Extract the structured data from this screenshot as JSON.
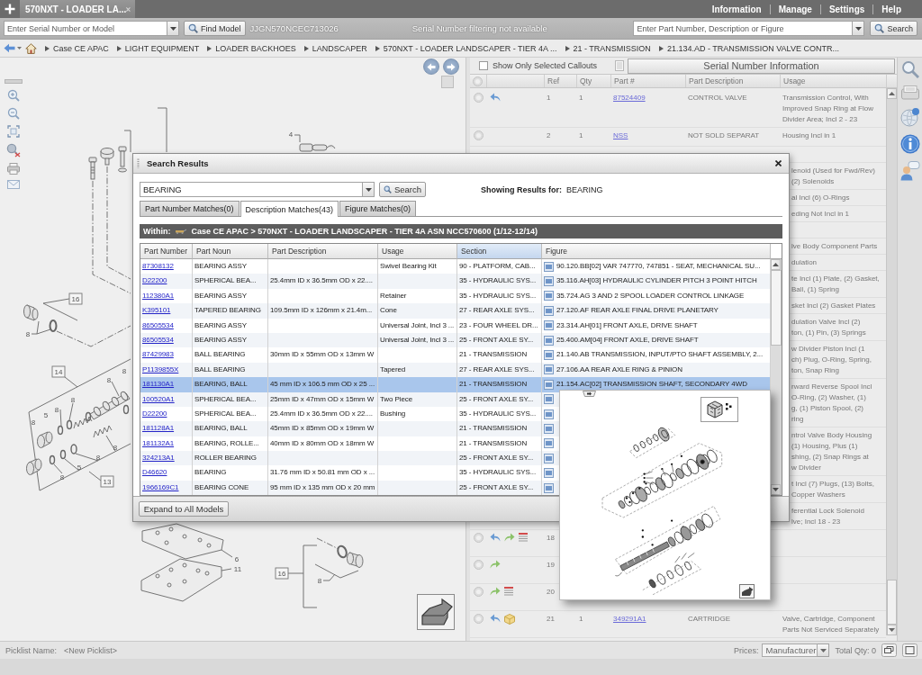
{
  "top_bar": {
    "tabs": [
      {
        "label": "570NXT - LOADER LA...",
        "selected": true
      }
    ],
    "links": [
      "Information",
      "Manage",
      "Settings",
      "Help"
    ]
  },
  "toolbar": {
    "serial_field": {
      "placeholder": "Enter Serial Number or Model"
    },
    "find_button": "Find Model",
    "serial_number": "JJGN570NCEC713026",
    "filter_status": "Serial Number filtering not available",
    "part_field": {
      "placeholder": "Enter Part Number, Description or Figure"
    },
    "search_button": "Search"
  },
  "breadcrumb": [
    "Case CE APAC",
    "LIGHT EQUIPMENT",
    "LOADER BACKHOES",
    "LANDSCAPER",
    "570NXT - LOADER LANDSCAPER - TIER 4A ...",
    "21 - TRANSMISSION",
    "21.134.AD - TRANSMISSION VALVE CONTR..."
  ],
  "diagram": {
    "callouts": [
      {
        "text": "4",
        "boxed": false
      },
      {
        "text": "16",
        "boxed": true
      },
      {
        "text": "8",
        "boxed": false
      },
      {
        "text": "14",
        "boxed": true
      },
      {
        "text": "8",
        "boxed": false
      },
      {
        "text": "8",
        "boxed": false
      },
      {
        "text": "8",
        "boxed": false
      },
      {
        "text": "8",
        "boxed": false
      },
      {
        "text": "5",
        "boxed": false
      },
      {
        "text": "8",
        "boxed": false
      },
      {
        "text": "8",
        "boxed": false
      },
      {
        "text": "8",
        "boxed": false
      },
      {
        "text": "5",
        "boxed": false
      },
      {
        "text": "8",
        "boxed": false
      },
      {
        "text": "13",
        "boxed": true
      },
      {
        "text": "6",
        "boxed": false
      },
      {
        "text": "11",
        "boxed": false
      },
      {
        "text": "16",
        "boxed": true
      },
      {
        "text": "8",
        "boxed": false
      }
    ]
  },
  "parts_panel": {
    "callout_filter": {
      "label": "Show Only Selected Callouts",
      "checked": false
    },
    "serial_info_button": "Serial Number Information",
    "columns": [
      "Ref",
      "Qty",
      "Part #",
      "Part Description",
      "Usage"
    ],
    "rows": [
      {
        "kind": "part",
        "ref": "1",
        "qty": "1",
        "part_number": "87524409",
        "description": "CONTROL VALVE",
        "usage": "Transmission Control, With Improved Snap Ring at Flow Divider Area; Incl 2 - 23",
        "back_ref": true,
        "forward_ref": false,
        "notes": false,
        "kit": false
      },
      {
        "kind": "part",
        "ref": "2",
        "qty": "1",
        "part_number": "NSS",
        "description": "NOT SOLD SEPARAT",
        "usage": "Housing Incl in 1",
        "back_ref": false,
        "forward_ref": false,
        "notes": false,
        "kit": false
      },
      {
        "kind": "covered"
      },
      {
        "kind": "covered",
        "usage": "lenoid (Used for Fwd/Rev)\n(2) Solenoids"
      },
      {
        "kind": "covered",
        "usage": "al Incl (6) O-Rings"
      },
      {
        "kind": "covered",
        "usage": "eding Not Incl in 1"
      },
      {
        "kind": "covered"
      },
      {
        "kind": "covered",
        "usage": "lve Body Component Parts"
      },
      {
        "kind": "covered",
        "usage": "dulation"
      },
      {
        "kind": "covered",
        "usage": "te Incl (1) Plate, (2) Gasket,\nBall, (1) Spring"
      },
      {
        "kind": "covered",
        "usage": "sket Incl (2) Gasket Plates"
      },
      {
        "kind": "covered",
        "usage": "dulation Valve Incl (2)\nton, (1) Pin, (3) Springs"
      },
      {
        "kind": "covered",
        "usage": "w Divider Piston Incl (1\nch) Plug, O-Ring, Spring,\nton, Snap Ring"
      },
      {
        "kind": "covered",
        "usage": "rward Reverse Spool Incl\nO-Ring, (2) Washer, (1)\ng, (1) Piston Spool, (2)\nring"
      },
      {
        "kind": "covered",
        "usage": "ntrol Valve Body Housing\n(1) Housing, Plus (1)\nshing, (2) Snap Rings at\nw Divider"
      },
      {
        "kind": "covered",
        "usage": "t Incl (7) Plugs, (13) Bolts,\nCopper Washers"
      },
      {
        "kind": "covered",
        "usage": "ferential Lock Solenoid\nlve; Incl 18 - 23"
      },
      {
        "kind": "part",
        "ref": "18",
        "back_ref": true,
        "forward_ref": true,
        "notes": true,
        "kit": false
      },
      {
        "kind": "part",
        "ref": "19",
        "back_ref": false,
        "forward_ref": true,
        "notes": false,
        "kit": false
      },
      {
        "kind": "part",
        "ref": "20",
        "back_ref": false,
        "forward_ref": true,
        "notes": true,
        "kit": false
      },
      {
        "kind": "part",
        "ref": "21",
        "qty": "1",
        "part_number": "349291A1",
        "description": "CARTRIDGE",
        "usage": "Valve, Cartridge, Component Parts Not Serviced Separately",
        "back_ref": true,
        "forward_ref": false,
        "notes": false,
        "kit": true
      }
    ]
  },
  "search_dialog": {
    "title": "Search Results",
    "query": "BEARING",
    "search_button": "Search",
    "results_label": "Showing Results for:",
    "results_query": "BEARING",
    "tabs": [
      {
        "label": "Part Number Matches(0)",
        "selected": false
      },
      {
        "label": "Description Matches(43)",
        "selected": true
      },
      {
        "label": "Figure Matches(0)",
        "selected": false
      }
    ],
    "within_label": "Within:",
    "within_path": "Case CE APAC > 570NXT - LOADER LANDSCAPER - TIER 4A ASN NCC570600 (1/12-12/14)",
    "columns": [
      {
        "label": "Part Number",
        "sorted": false
      },
      {
        "label": "Part Noun",
        "sorted": false
      },
      {
        "label": "Part Description",
        "sorted": false
      },
      {
        "label": "Usage",
        "sorted": false
      },
      {
        "label": "Section",
        "sorted": true
      },
      {
        "label": "Figure",
        "sorted": false
      }
    ],
    "rows": [
      {
        "part_number": "87308132",
        "noun": "BEARING ASSY",
        "usage": "Swivel Bearing Kit",
        "section": "90 - PLATFORM, CAB...",
        "figure": "90.120.BB[02] VAR 747770, 747851 - SEAT, MECHANICAL SU...",
        "selected": false
      },
      {
        "part_number": "D22200",
        "noun": "SPHERICAL BEA...",
        "description": "25.4mm ID x 36.5mm OD x 22....",
        "section": "35 - HYDRAULIC SYS...",
        "figure": "35.116.AH[03] HYDRAULIC CYLINDER PITCH 3 POINT HITCH",
        "selected": false
      },
      {
        "part_number": "112380A1",
        "noun": "BEARING ASSY",
        "usage": "Retainer",
        "section": "35 - HYDRAULIC SYS...",
        "figure": "35.724.AG 3 AND 2 SPOOL LOADER CONTROL LINKAGE",
        "selected": false
      },
      {
        "part_number": "K395101",
        "noun": "TAPERED BEARING",
        "description": "109.5mm ID x 126mm x 21.4m...",
        "usage": "Cone",
        "section": "27 - REAR AXLE SYS...",
        "figure": "27.120.AF REAR AXLE FINAL DRIVE PLANETARY",
        "selected": false
      },
      {
        "part_number": "86505534",
        "noun": "BEARING ASSY",
        "usage": "Universal Joint, Incl 3 ...",
        "section": "23 - FOUR WHEEL DR...",
        "figure": "23.314.AH[01] FRONT AXLE, DRIVE SHAFT",
        "selected": false
      },
      {
        "part_number": "86505534",
        "noun": "BEARING ASSY",
        "usage": "Universal Joint, Incl 3 ...",
        "section": "25 - FRONT AXLE SY...",
        "figure": "25.400.AM[04] FRONT AXLE, DRIVE SHAFT",
        "selected": false
      },
      {
        "part_number": "87429983",
        "noun": "BALL BEARING",
        "description": "30mm ID x 55mm OD x 13mm W",
        "section": "21 - TRANSMISSION",
        "figure": "21.140.AB TRANSMISSION, INPUT/PTO SHAFT ASSEMBLY, 2...",
        "selected": false
      },
      {
        "part_number": "P1139855X",
        "noun": "BALL BEARING",
        "usage": "Tapered",
        "section": "27 - REAR AXLE SYS...",
        "figure": "27.106.AA REAR AXLE RING & PINION",
        "selected": false
      },
      {
        "part_number": "181130A1",
        "noun": "BEARING, BALL",
        "description": "45 mm ID x 106.5 mm OD x 25 ...",
        "section": "21 - TRANSMISSION",
        "figure": "21.154.AC[02] TRANSMISSION SHAFT, SECONDARY 4WD",
        "selected": true
      },
      {
        "part_number": "100520A1",
        "noun": "SPHERICAL BEA...",
        "description": "25mm ID x 47mm OD x 15mm W",
        "usage": "Two Piece",
        "section": "25 - FRONT AXLE SY...",
        "selected": false
      },
      {
        "part_number": "D22200",
        "noun": "SPHERICAL BEA...",
        "description": "25.4mm ID x 36.5mm OD x 22....",
        "usage": "Bushing",
        "section": "35 - HYDRAULIC SYS...",
        "selected": false
      },
      {
        "part_number": "181128A1",
        "noun": "BEARING, BALL",
        "description": "45mm ID x 85mm OD x 19mm W",
        "section": "21 - TRANSMISSION",
        "selected": false
      },
      {
        "part_number": "181132A1",
        "noun": "BEARING, ROLLE...",
        "description": "40mm ID x 80mm OD x 18mm W",
        "section": "21 - TRANSMISSION",
        "selected": false
      },
      {
        "part_number": "324213A1",
        "noun": "ROLLER BEARING",
        "section": "25 - FRONT AXLE SY...",
        "selected": false
      },
      {
        "part_number": "D46620",
        "noun": "BEARING",
        "description": "31.76 mm ID x 50.81 mm OD x ...",
        "section": "35 - HYDRAULIC SYS...",
        "selected": false
      },
      {
        "part_number": "1966169C1",
        "noun": "BEARING CONE",
        "description": "95 mm ID x 135 mm OD x 20 mm",
        "section": "25 - FRONT AXLE SY...",
        "selected": false
      }
    ],
    "expand_button": "Expand to All Models"
  },
  "status_bar": {
    "picklist_label": "Picklist Name:",
    "picklist_name": "<New Picklist>",
    "prices_label": "Prices:",
    "prices_value": "Manufacturer",
    "total_qty": "Total Qty: 0"
  }
}
